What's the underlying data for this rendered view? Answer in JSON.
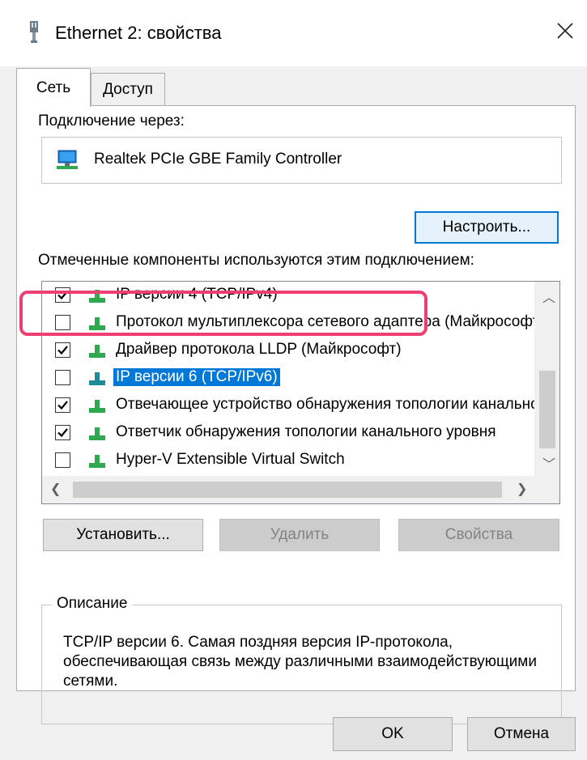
{
  "window": {
    "title": "Ethernet 2: свойства",
    "close_label": "✕"
  },
  "tabs": [
    {
      "label": "Сеть",
      "active": true
    },
    {
      "label": "Доступ",
      "active": false
    }
  ],
  "connect_via": {
    "label": "Подключение через:",
    "adapter": "Realtek PCIe GBE Family Controller"
  },
  "configure_button": "Настроить...",
  "components_label": "Отмеченные компоненты используются этим подключением:",
  "components": [
    {
      "label": "IP версии 4 (TCP/IPv4)",
      "checked": true,
      "selected": false
    },
    {
      "label": "Протокол мультиплексора сетевого адаптера (Майкрософт)",
      "checked": false,
      "selected": false
    },
    {
      "label": "Драйвер протокола LLDP (Майкрософт)",
      "checked": true,
      "selected": false
    },
    {
      "label": "IP версии 6 (TCP/IPv6)",
      "checked": false,
      "selected": true
    },
    {
      "label": "Отвечающее устройство обнаружения топологии канального уровня",
      "checked": true,
      "selected": false
    },
    {
      "label": "Ответчик обнаружения топологии канального уровня",
      "checked": true,
      "selected": false
    },
    {
      "label": "Hyper-V Extensible Virtual Switch",
      "checked": false,
      "selected": false
    }
  ],
  "buttons": {
    "install": "Установить...",
    "remove": "Удалить",
    "properties": "Свойства",
    "ok": "OK",
    "cancel": "Отмена"
  },
  "description": {
    "legend": "Описание",
    "text": "TCP/IP версии 6. Самая поздняя версия IP-протокола, обеспечивающая связь между различными взаимодействующими сетями."
  },
  "colors": {
    "selection": "#0078d7",
    "annotation": "#ee3f73",
    "net_icon_green": "#2fa84f"
  }
}
